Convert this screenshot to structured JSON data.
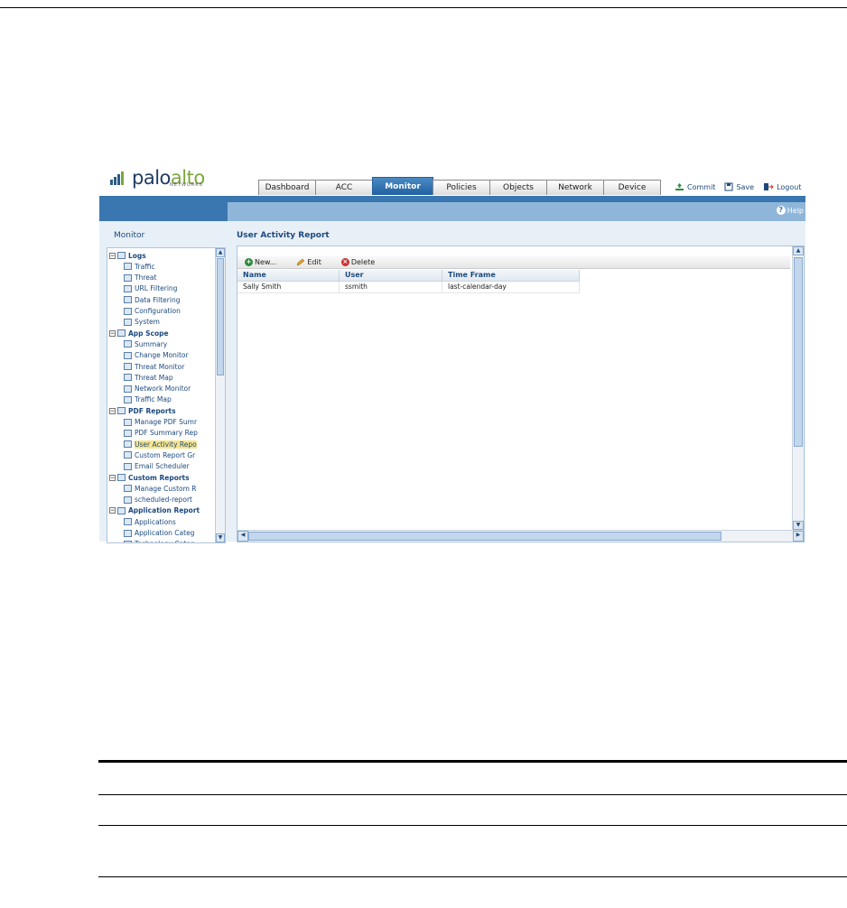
{
  "brand": {
    "logo_main": "palo",
    "logo_accent": "alto",
    "logo_sub": "NETWORKS"
  },
  "tabs": [
    {
      "label": "Dashboard"
    },
    {
      "label": "ACC"
    },
    {
      "label": "Monitor",
      "active": true
    },
    {
      "label": "Policies"
    },
    {
      "label": "Objects"
    },
    {
      "label": "Network"
    },
    {
      "label": "Device"
    }
  ],
  "actions": {
    "commit": "Commit",
    "save": "Save",
    "logout": "Logout"
  },
  "help_label": "Help",
  "sidebar": {
    "title": "Monitor",
    "tree": [
      {
        "label": "Logs",
        "group": true
      },
      {
        "label": "Traffic"
      },
      {
        "label": "Threat"
      },
      {
        "label": "URL Filtering"
      },
      {
        "label": "Data Filtering"
      },
      {
        "label": "Configuration"
      },
      {
        "label": "System"
      },
      {
        "label": "App Scope",
        "group": true
      },
      {
        "label": "Summary"
      },
      {
        "label": "Change Monitor"
      },
      {
        "label": "Threat Monitor"
      },
      {
        "label": "Threat Map"
      },
      {
        "label": "Network Monitor"
      },
      {
        "label": "Traffic Map"
      },
      {
        "label": "PDF Reports",
        "group": true
      },
      {
        "label": "Manage PDF Sumr"
      },
      {
        "label": "PDF Summary Rep"
      },
      {
        "label": "User Activity Repo",
        "selected": true
      },
      {
        "label": "Custom Report Gr"
      },
      {
        "label": "Email Scheduler"
      },
      {
        "label": "Custom Reports",
        "group": true
      },
      {
        "label": "Manage Custom R"
      },
      {
        "label": "scheduled-report"
      },
      {
        "label": "Application Report",
        "group": true
      },
      {
        "label": "Applications"
      },
      {
        "label": "Application Categ"
      },
      {
        "label": "Technology Categ"
      }
    ]
  },
  "content": {
    "title": "User Activity Report",
    "toolbar": {
      "new": "New...",
      "edit": "Edit",
      "delete": "Delete"
    },
    "columns": [
      "Name",
      "User",
      "Time Frame"
    ],
    "rows": [
      [
        "Sally Smith",
        "ssmith",
        "last-calendar-day"
      ]
    ]
  },
  "colors": {
    "header_blue": "#3a77b0",
    "selected_row": "#f8e58a",
    "link": "#1c4a7e"
  }
}
